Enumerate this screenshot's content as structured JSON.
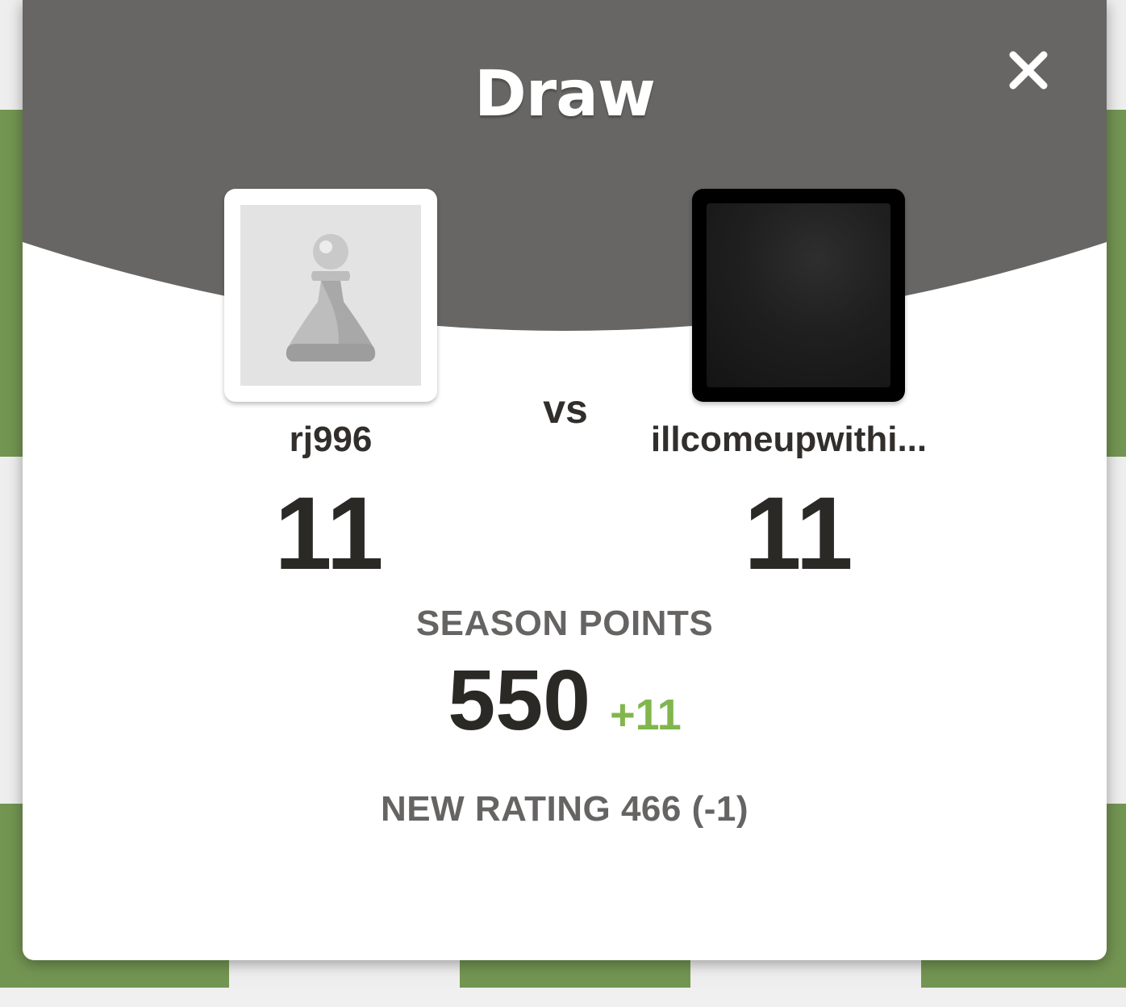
{
  "colors": {
    "header_bg": "#676665",
    "board_light": "#eeeeee",
    "board_dark": "#739552",
    "delta_positive": "#81b64c",
    "text_dark": "#2b2926",
    "text_muted": "#666463"
  },
  "modal": {
    "title": "Draw",
    "close_icon": "close-icon"
  },
  "players": {
    "left": {
      "username": "rj996",
      "score": "11",
      "avatar_icon": "pawn-icon"
    },
    "right": {
      "username": "illcomeupwithi...",
      "score": "11"
    },
    "vs_label": "vs"
  },
  "season": {
    "label": "SEASON POINTS",
    "value": "550",
    "delta": "+11"
  },
  "rating": {
    "text": "NEW RATING 466 (-1)"
  }
}
